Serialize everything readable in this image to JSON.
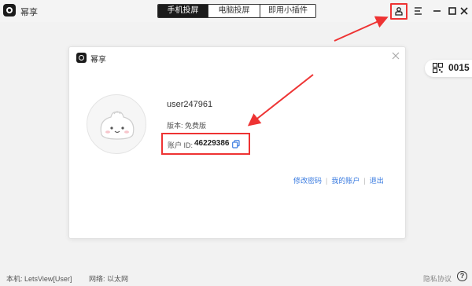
{
  "app": {
    "title": "幂享"
  },
  "tabs": [
    {
      "label": "手机投屏",
      "active": true
    },
    {
      "label": "电脑投屏",
      "active": false
    },
    {
      "label": "即用小插件",
      "active": false
    }
  ],
  "toolbar": {
    "user_icon": "user-icon",
    "menu_icon": "menu-icon",
    "minimize_icon": "minimize-icon",
    "maximize_icon": "maximize-icon",
    "close_icon": "close-icon"
  },
  "code_pill": {
    "code": "0015"
  },
  "dialog": {
    "title": "幂享",
    "username": "user247961",
    "version_label": "版本:",
    "version_value": "免费版",
    "account_id_label": "账户 ID:",
    "account_id_value": "46229386",
    "links": [
      "修改密码",
      "我的账户",
      "退出"
    ]
  },
  "status": {
    "host_label": "本机:",
    "host_value": "LetsView[User]",
    "network_label": "网络:",
    "network_value": "以太网",
    "privacy": "隐私协议",
    "help": "?"
  },
  "colors": {
    "accent": "#3a7be0",
    "highlight": "#e33333",
    "dark": "#1b1b1b"
  }
}
